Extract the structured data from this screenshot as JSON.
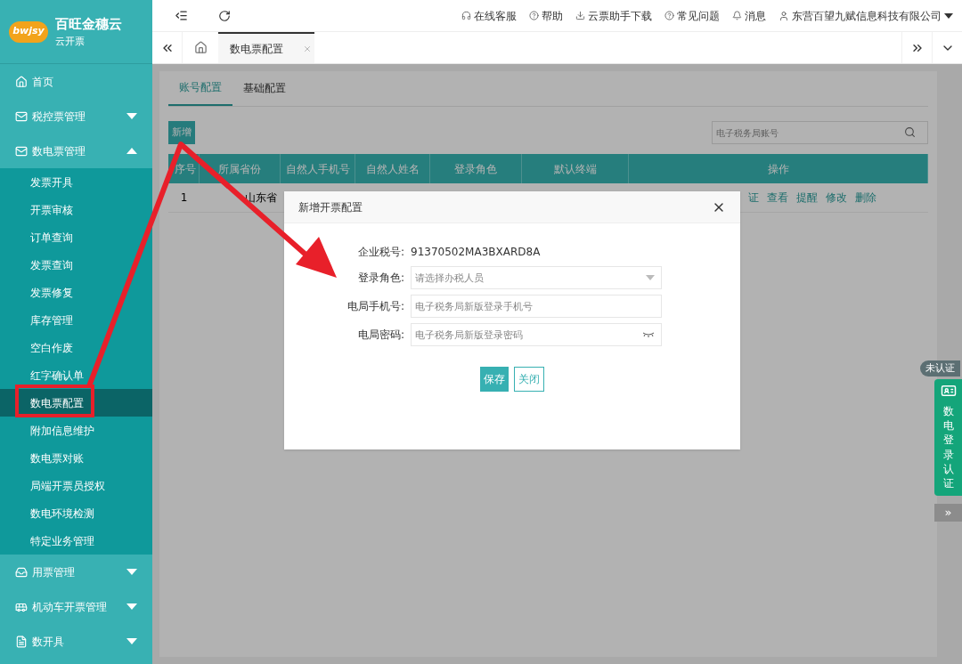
{
  "brand": {
    "mark": "bwjsy",
    "name": "百旺金穗云",
    "subtitle": "云开票"
  },
  "sidebar": {
    "items": [
      {
        "label": "首页",
        "kind": "home"
      },
      {
        "label": "税控票管理",
        "kind": "mail",
        "expanded": false
      },
      {
        "label": "数电票管理",
        "kind": "mail",
        "expanded": true,
        "children": [
          {
            "label": "发票开具",
            "selected": false
          },
          {
            "label": "开票审核",
            "selected": false
          },
          {
            "label": "订单查询",
            "selected": false
          },
          {
            "label": "发票查询",
            "selected": false
          },
          {
            "label": "发票修复",
            "selected": false
          },
          {
            "label": "库存管理",
            "selected": false
          },
          {
            "label": "空白作废",
            "selected": false
          },
          {
            "label": "红字确认单",
            "selected": false
          },
          {
            "label": "数电票配置",
            "selected": true
          },
          {
            "label": "附加信息维护",
            "selected": false
          },
          {
            "label": "数电票对账",
            "selected": false
          },
          {
            "label": "局端开票员授权",
            "selected": false
          },
          {
            "label": "数电环境检测",
            "selected": false
          },
          {
            "label": "特定业务管理",
            "selected": false
          }
        ]
      },
      {
        "label": "用票管理",
        "kind": "inbox",
        "expanded": false
      },
      {
        "label": "机动车开票管理",
        "kind": "bus",
        "expanded": false
      },
      {
        "label": "数开具",
        "kind": "doc",
        "expanded": false
      }
    ]
  },
  "header": {
    "links": [
      {
        "label": "在线客服",
        "kind": "headset"
      },
      {
        "label": "帮助",
        "kind": "help"
      },
      {
        "label": "云票助手下载",
        "kind": "download"
      },
      {
        "label": "常见问题",
        "kind": "help"
      },
      {
        "label": "消息",
        "kind": "bell"
      }
    ],
    "company": "东营百望九赋信息科技有限公司"
  },
  "page_tabs": [
    {
      "label": "数电票配置",
      "selected": true
    }
  ],
  "content_tabs": [
    {
      "label": "账号配置",
      "selected": true
    },
    {
      "label": "基础配置",
      "selected": false
    }
  ],
  "add_button": "新增",
  "search": {
    "placeholder": "电子税务局账号"
  },
  "table": {
    "columns": [
      "序号",
      "所属省份",
      "自然人手机号",
      "自然人姓名",
      "登录角色",
      "默认终端",
      "操作"
    ],
    "rows": [
      {
        "index": "1",
        "province": "山东省",
        "actions": [
          "证",
          "查看",
          "提醒",
          "修改",
          "删除"
        ]
      }
    ]
  },
  "dialog": {
    "title": "新增开票配置",
    "tax_label": "企业税号:",
    "tax_value": "91370502MA3BXARD8A",
    "fields": [
      {
        "label": "登录角色:",
        "placeholder": "请选择办税人员",
        "kind": "select"
      },
      {
        "label": "电局手机号:",
        "placeholder": "电子税务局新版登录手机号",
        "kind": "text"
      },
      {
        "label": "电局密码:",
        "placeholder": "电子税务局新版登录密码",
        "kind": "password"
      }
    ],
    "buttons": [
      {
        "label": "保存",
        "kind": "primary"
      },
      {
        "label": "关闭",
        "kind": "secondary"
      }
    ]
  },
  "auth_widget": {
    "status": "未认证",
    "label": "数电登录认证",
    "collapse": "»"
  }
}
